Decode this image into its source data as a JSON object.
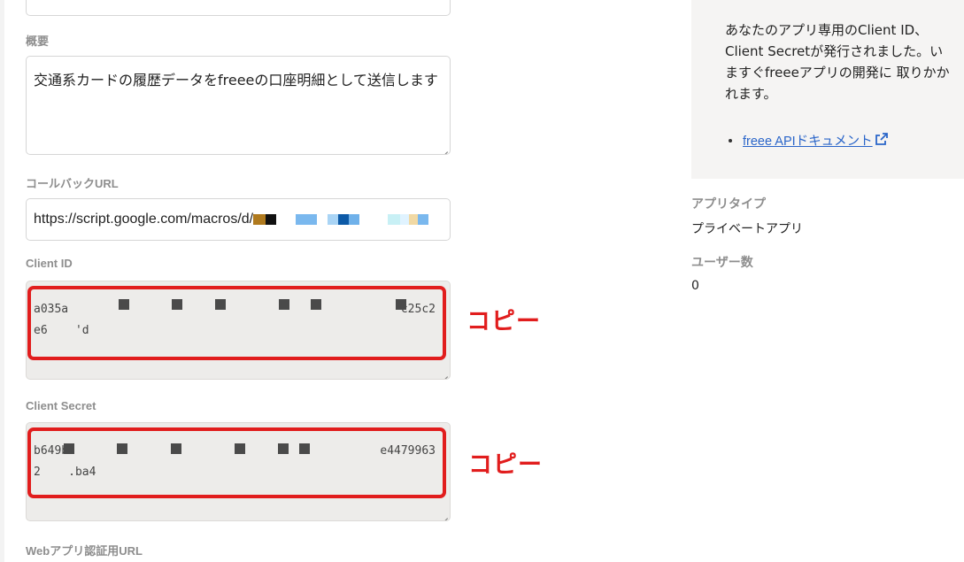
{
  "form": {
    "summary": {
      "label": "概要",
      "value": "交通系カードの履歴データをfreeeの口座明細として送信します"
    },
    "callback_url": {
      "label": "コールバックURL",
      "value": "https://script.google.com/macros/d/"
    },
    "client_id": {
      "label": "Client ID",
      "value_line1_start": "a035a",
      "value_line1_end": "c25c2",
      "value_line2": "e6    'd"
    },
    "client_secret": {
      "label": "Client Secret",
      "value_line1_start": "b649b",
      "value_line1_end": "e4479963",
      "value_line2": "2    .ba4"
    },
    "web_app_auth_url": {
      "label": "Webアプリ認証用URL"
    }
  },
  "annotations": {
    "copy_label_1": "コピー",
    "copy_label_2": "コピー",
    "highlight_color": "#e11d1d"
  },
  "sidebar": {
    "notice": {
      "text": "あなたのアプリ専用のClient ID、Client Secretが発行されました。いますぐfreeeアプリの開発に 取りかかれます。",
      "link_label": "freee APIドキュメント",
      "link_icon": "external-link-icon"
    },
    "app_type": {
      "label": "アプリタイプ",
      "value": "プライベートアプリ"
    },
    "user_count": {
      "label": "ユーザー数",
      "value": "0"
    }
  },
  "colors": {
    "link": "#2a65c9",
    "readonly_bg": "#edecea",
    "notice_bg": "#f5f4f3"
  }
}
